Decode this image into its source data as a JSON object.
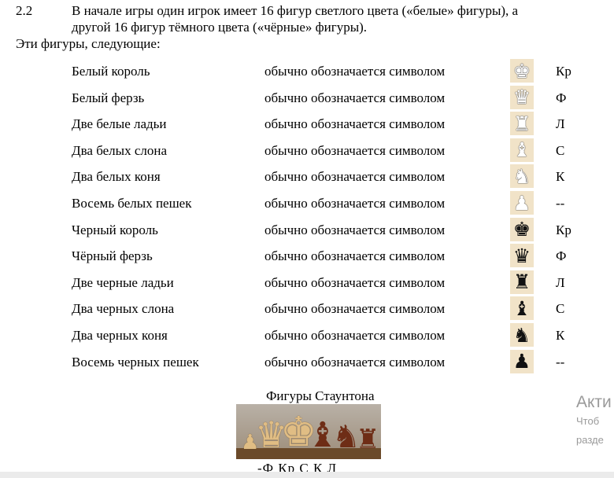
{
  "section": {
    "number": "2.2",
    "paragraph_line1": "В начале игры один игрок имеет 16 фигур светлого цвета («белые» фигуры), а",
    "paragraph_line2": "другой 16 фигур тёмного цвета («чёрные» фигуры).",
    "intro": "Эти фигуры, следующие:"
  },
  "pieces": [
    {
      "name": "Белый король",
      "desc": "обычно обозначается символом",
      "icon": "white-king-icon",
      "glyph": "♚",
      "color": "white",
      "symbol": "Кр"
    },
    {
      "name": "Белый ферзь",
      "desc": "обычно обозначается символом",
      "icon": "white-queen-icon",
      "glyph": "♛",
      "color": "white",
      "symbol": "Ф"
    },
    {
      "name": "Две белые ладьи",
      "desc": "обычно обозначается символом",
      "icon": "white-rook-icon",
      "glyph": "♜",
      "color": "white",
      "symbol": "Л"
    },
    {
      "name": "Два белых слона",
      "desc": "обычно обозначается символом",
      "icon": "white-bishop-icon",
      "glyph": "♝",
      "color": "white",
      "symbol": "С"
    },
    {
      "name": "Два белых коня",
      "desc": "обычно обозначается символом",
      "icon": "white-knight-icon",
      "glyph": "♞",
      "color": "white",
      "symbol": "К"
    },
    {
      "name": "Восемь белых пешек",
      "desc": "обычно обозначается символом",
      "icon": "white-pawn-icon",
      "glyph": "♟",
      "color": "white",
      "symbol": "--"
    },
    {
      "name": "Черный король",
      "desc": "обычно обозначается символом",
      "icon": "black-king-icon",
      "glyph": "♚",
      "color": "black",
      "symbol": "Кр"
    },
    {
      "name": "Чёрный ферзь",
      "desc": "обычно обозначается символом",
      "icon": "black-queen-icon",
      "glyph": "♛",
      "color": "black",
      "symbol": "Ф"
    },
    {
      "name": "Две черные ладьи",
      "desc": "обычно обозначается символом",
      "icon": "black-rook-icon",
      "glyph": "♜",
      "color": "black",
      "symbol": "Л"
    },
    {
      "name": "Два черных слона",
      "desc": "обычно обозначается символом",
      "icon": "black-bishop-icon",
      "glyph": "♝",
      "color": "black",
      "symbol": "С"
    },
    {
      "name": "Два черных коня",
      "desc": "обычно обозначается символом",
      "icon": "black-knight-icon",
      "glyph": "♞",
      "color": "black",
      "symbol": "К"
    },
    {
      "name": "Восемь черных пешек",
      "desc": "обычно обозначается символом",
      "icon": "black-pawn-icon",
      "glyph": "♟",
      "color": "black",
      "symbol": "--"
    }
  ],
  "figure": {
    "caption": "Фигуры Стаунтона",
    "bottom_labels": "-Ф  Кр  С   К   Л"
  },
  "watermark": {
    "line1": "Акти",
    "line2": "Чтоб",
    "line3": "разде"
  },
  "colors": {
    "icon_background": "#f1e3c8",
    "watermark": "#9a9a9a"
  }
}
